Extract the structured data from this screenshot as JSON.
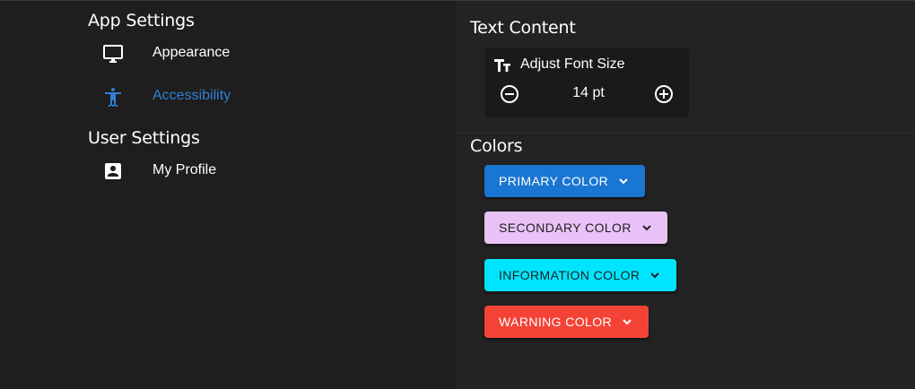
{
  "sidebar": {
    "app_settings_title": "App Settings",
    "user_settings_title": "User Settings",
    "items": [
      {
        "label": "Appearance",
        "icon": "monitor-icon",
        "active": false
      },
      {
        "label": "Accessibility",
        "icon": "accessibility-icon",
        "active": true
      },
      {
        "label": "My Profile",
        "icon": "account-box-icon",
        "active": false
      }
    ]
  },
  "main": {
    "text_content_title": "Text Content",
    "font_size": {
      "label": "Adjust Font Size",
      "value": "14 pt",
      "icon": "text-size-icon",
      "decrease_icon": "minus-circle-icon",
      "increase_icon": "plus-circle-icon"
    },
    "colors_title": "Colors",
    "color_buttons": [
      {
        "label": "PRIMARY COLOR",
        "bg": "#1976d2",
        "fg": "#ffffff"
      },
      {
        "label": "SECONDARY COLOR",
        "bg": "#e9c2f7",
        "fg": "#222222"
      },
      {
        "label": "INFORMATION COLOR",
        "bg": "#00e5ff",
        "fg": "#222222"
      },
      {
        "label": "WARNING COLOR",
        "bg": "#f44336",
        "fg": "#ffffff"
      }
    ]
  },
  "theme": {
    "active_color": "#2f80d6",
    "background": "#1e1e1e",
    "panel": "#232323"
  }
}
